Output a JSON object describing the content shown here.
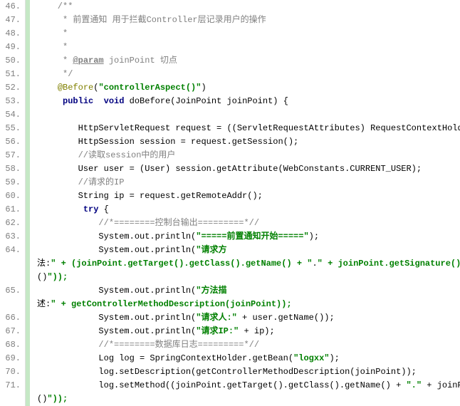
{
  "lines": [
    {
      "num": "46.",
      "text": "    /**",
      "cls": "comment"
    },
    {
      "num": "47.",
      "text": "     * 前置通知 用于拦截Controller层记录用户的操作",
      "cls": "comment"
    },
    {
      "num": "48.",
      "text": "     *",
      "cls": "comment"
    },
    {
      "num": "49.",
      "text": "     *",
      "cls": "comment"
    },
    {
      "num": "50.",
      "text": "     * @param joinPoint 切点",
      "cls": "comment"
    },
    {
      "num": "51.",
      "text": "     */",
      "cls": "comment"
    },
    {
      "num": "52.",
      "text": "    @Before(\"controllerAspect()\")",
      "cls": "annotation"
    },
    {
      "num": "53.",
      "text": "     public  void doBefore(JoinPoint joinPoint) {",
      "cls": "plain"
    },
    {
      "num": "54.",
      "text": "",
      "cls": "plain"
    },
    {
      "num": "55.",
      "text": "        HttpServletRequest request = ((ServletRequestAttributes) RequestContextHolder.ge",
      "cls": "plain"
    },
    {
      "num": "56.",
      "text": "        HttpSession session = request.getSession();",
      "cls": "plain"
    },
    {
      "num": "57.",
      "text": "        //读取session中的用户",
      "cls": "comment"
    },
    {
      "num": "58.",
      "text": "        User user = (User) session.getAttribute(WebConstants.CURRENT_USER);",
      "cls": "plain"
    },
    {
      "num": "59.",
      "text": "        //请求的IP",
      "cls": "comment"
    },
    {
      "num": "60.",
      "text": "        String ip = request.getRemoteAddr();",
      "cls": "plain"
    },
    {
      "num": "61.",
      "text": "         try {",
      "cls": "plain"
    },
    {
      "num": "62.",
      "text": "            //*========控制台输出=========*//",
      "cls": "comment"
    },
    {
      "num": "63.",
      "text": "            System.out.println(\"=====前置通知开始=====\");",
      "cls": "plain"
    },
    {
      "num": "64.",
      "text": "            System.out.println(\"请求方",
      "cls": "plain"
    },
    {
      "num": "",
      "text": "法:\" + (joinPoint.getTarget().getClass().getName() + \".\" + joinPoint.getSignature().getN",
      "cls": "plain"
    },
    {
      "num": "",
      "text": "()\"));",
      "cls": "plain"
    },
    {
      "num": "65.",
      "text": "            System.out.println(\"方法描",
      "cls": "plain"
    },
    {
      "num": "",
      "text": "述:\" + getControllerMethodDescription(joinPoint));",
      "cls": "plain"
    },
    {
      "num": "66.",
      "text": "            System.out.println(\"请求人:\" + user.getName());",
      "cls": "plain"
    },
    {
      "num": "67.",
      "text": "            System.out.println(\"请求IP:\" + ip);",
      "cls": "plain"
    },
    {
      "num": "68.",
      "text": "            //*========数据库日志=========*//",
      "cls": "comment"
    },
    {
      "num": "69.",
      "text": "            Log log = SpringContextHolder.getBean(\"logxx\");",
      "cls": "plain"
    },
    {
      "num": "70.",
      "text": "            log.setDescription(getControllerMethodDescription(joinPoint));",
      "cls": "plain"
    },
    {
      "num": "71.",
      "text": "            log.setMethod((joinPoint.getTarget().getClass().getName() + \".\" + joinPoint.",
      "cls": "plain"
    },
    {
      "num": "",
      "text": "()\"));",
      "cls": "plain"
    }
  ],
  "tokens": {
    "keywords": [
      "public",
      "void",
      "try"
    ],
    "annotation": "@Before",
    "param": "@param"
  }
}
